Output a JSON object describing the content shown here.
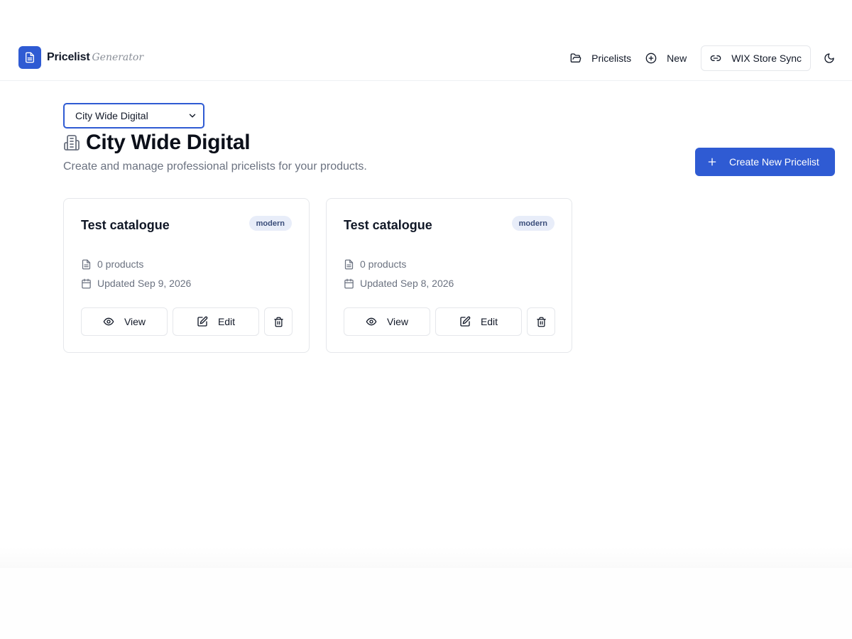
{
  "brand": {
    "name": "Pricelist",
    "sub": "Generator"
  },
  "nav": {
    "pricelists": "Pricelists",
    "new": "New",
    "sync": "WIX Store Sync"
  },
  "store_select": {
    "value": "City Wide Digital"
  },
  "page": {
    "title": "City Wide Digital",
    "subtitle": "Create and manage professional pricelists for your products.",
    "create_label": "Create New Pricelist"
  },
  "cards": [
    {
      "title": "Test catalogue",
      "badge": "modern",
      "products": "0 products",
      "updated": "Updated Sep 9, 2026",
      "view_label": "View",
      "edit_label": "Edit"
    },
    {
      "title": "Test catalogue",
      "badge": "modern",
      "products": "0 products",
      "updated": "Updated Sep 8, 2026",
      "view_label": "View",
      "edit_label": "Edit"
    }
  ],
  "colors": {
    "accent": "#2f5bd3",
    "badge_bg": "#e8edf9"
  }
}
